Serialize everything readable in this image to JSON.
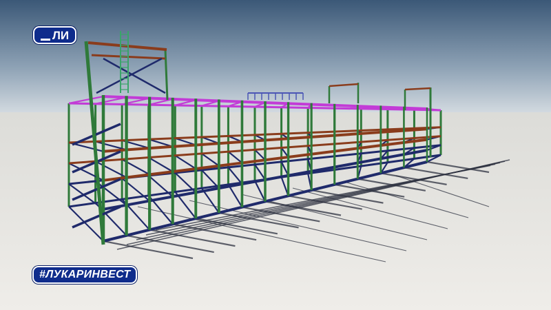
{
  "logo": {
    "text": "ЛИ"
  },
  "hashtag": {
    "text": "#ЛУКАРИНВЕСТ"
  },
  "colors": {
    "sky_top": "#3d5a78",
    "sky_bottom": "#c9d3dc",
    "ground": "#e8e6e2",
    "column": "#2f7a3a",
    "beam_dark": "#1f2a6b",
    "beam_rust": "#8a3c1c",
    "beam_magenta": "#c23bd6",
    "shadow": "#2e3140",
    "badge_bg": "#0f2c8c"
  }
}
